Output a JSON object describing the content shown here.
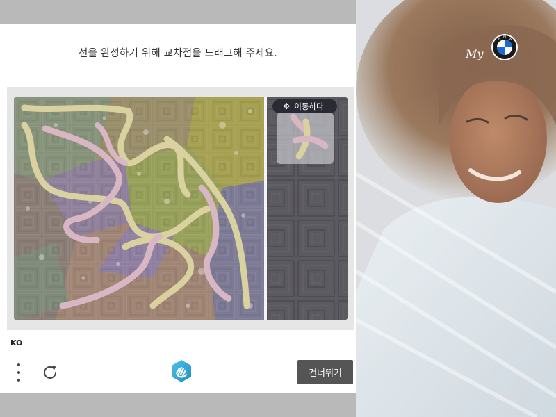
{
  "captcha": {
    "prompt": "선을 완성하기 위해 교차점을 드래그해 주세요.",
    "move_label": "이동하다",
    "language": "KO",
    "skip_label": "건너뛰기",
    "icons": {
      "more": "more-vertical-icon",
      "refresh": "refresh-icon",
      "brand": "hand-logo-icon",
      "move": "move-arrows-icon"
    }
  },
  "photo": {
    "logo_text": "My",
    "logo_roundel_letters": "BMW"
  }
}
